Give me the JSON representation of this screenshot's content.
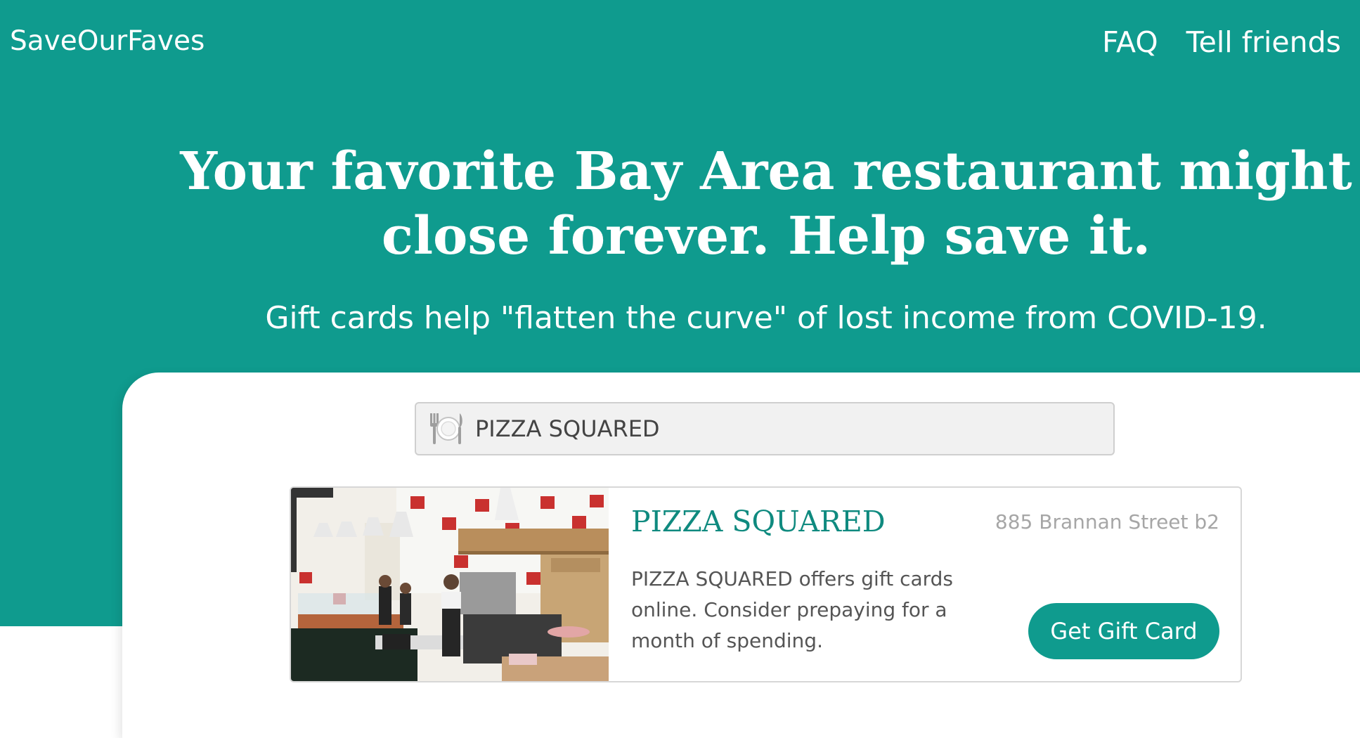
{
  "nav": {
    "brand": "SaveOurFaves",
    "links": [
      {
        "label": "FAQ"
      },
      {
        "label": "Tell friends"
      }
    ]
  },
  "hero": {
    "headline": "Your favorite Bay Area restaurant might close forever. Help save it.",
    "subhead": "Gift cards help \"flatten the curve\" of lost income from COVID-19."
  },
  "search": {
    "icon": "plate-cutlery-icon",
    "value": "PIZZA SQUARED"
  },
  "result": {
    "name": "PIZZA SQUARED",
    "address": "885 Brannan Street b2",
    "description": "PIZZA SQUARED offers gift cards online. Consider prepaying for a month of spending.",
    "button_label": "Get Gift Card",
    "photo": "restaurant-interior-photo"
  },
  "colors": {
    "brand": "#0f9b8e",
    "title_teal": "#0f8a7f",
    "address_gray": "#a6a6a6",
    "text_gray": "#555555"
  }
}
